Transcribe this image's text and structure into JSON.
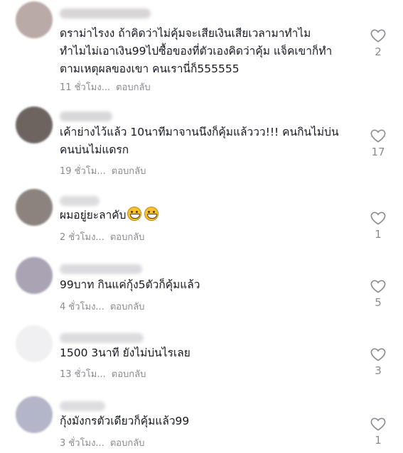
{
  "comments": [
    {
      "text": "ดราม่าไรงง ถ้าคิดว่าไม่คุ้มจะเสียเงินเสียเวลามาทำไม\nทำไมไม่เอาเงิน99ไปซื้อของที่ตัวเองคิดว่าคุ้ม แจ็คเขาก็ทำ\nตามเหตุผลของเขา คนเรานี่ก็555555",
      "time": "11 ชั่วโมง...",
      "reply": "ตอบกลับ",
      "likes": "2",
      "avatar_color": "#b9aaa8"
    },
    {
      "text": "เค้าย่างไว้แล้ว 10นาทีมาจานนึงก็คุ้มแล้ววว!!! คนกินไม่บ่น\nคนบ่นไม่แดรก",
      "time": "19 ชั่วโม...",
      "reply": "ตอบกลับ",
      "likes": "17",
      "avatar_color": "#6d6460"
    },
    {
      "text": "ผมอยู่ยะลาคับ",
      "time": "2 ชั่วโมง...",
      "reply": "ตอบกลับ",
      "likes": "1",
      "avatar_color": "#8c837f"
    },
    {
      "text": "99บาท กินแค่กุ้ง5ตัวก็คุ้มแล้ว",
      "time": "4 ชั่วโมง...",
      "reply": "ตอบกลับ",
      "likes": "5",
      "avatar_color": "#a9a3b4"
    },
    {
      "text": "1500 3นาที ยังไม่บ่นไรเลย",
      "time": "13 ชั่วโม...",
      "reply": "ตอบกลับ",
      "likes": "3",
      "avatar_color": "#f0f0f2"
    },
    {
      "text": "กุ้งมังกรตัวเดียวก็คุ้มแล้ว99",
      "time": "3 ชั่วโมง...",
      "reply": "ตอบกลับ",
      "likes": "1",
      "avatar_color": "#b3b6c8"
    }
  ]
}
